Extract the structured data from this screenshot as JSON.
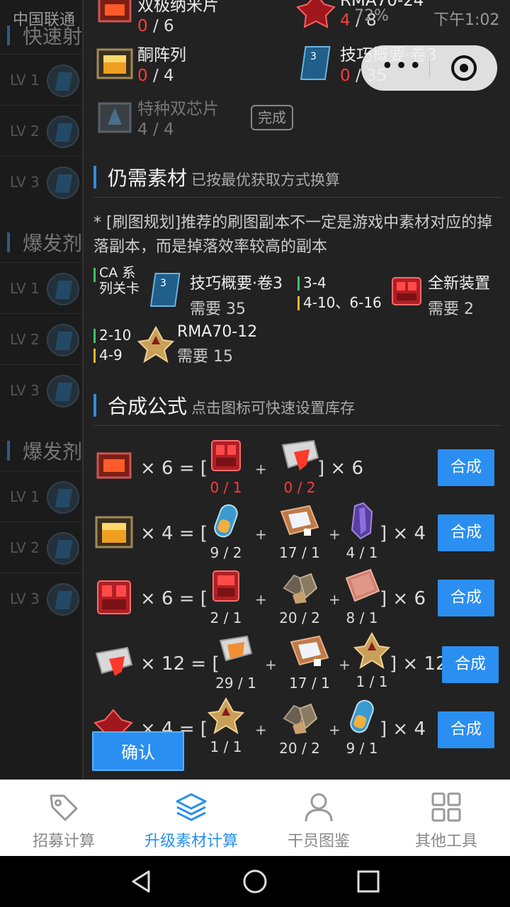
{
  "status_bar": {
    "carrier": "中国联通",
    "battery": "72%",
    "time": "下午1:02"
  },
  "background": {
    "sections": [
      "快速射",
      "爆发剂",
      "爆发剂"
    ],
    "levels": [
      "LV 1",
      "LV 2",
      "LV 3"
    ]
  },
  "dialog": {
    "owned": [
      {
        "name": "双极纳米片",
        "have": "0",
        "need": "/ 6",
        "icon": "nanoflake-icon"
      },
      {
        "name": "RMA70-24",
        "have": "4",
        "need": "/ 8",
        "icon": "rma70-24-icon"
      },
      {
        "name": "酮阵列",
        "have": "0",
        "need": "/ 4",
        "icon": "ketone-array-icon"
      },
      {
        "name": "技巧概要·卷3",
        "have": "0",
        "need": "/ 35",
        "icon": "skill-summary-3-icon"
      },
      {
        "name": "特种双芯片",
        "count": "4 / 4",
        "icon": "dualchip-icon"
      }
    ],
    "done_label": "完成",
    "still_needed": {
      "title": "仍需素材",
      "subtitle": "已按最优获取方式换算",
      "note": "* [刷图规划]推荐的刷图副本不一定是游戏中素材对应的掉落副本，而是掉落效率较高的副本",
      "ca_label": "CA 系列关卡",
      "items": [
        {
          "name": "技巧概要·卷3",
          "need": "需要 35",
          "stages": []
        },
        {
          "name": "全新装置",
          "need": "需要 2",
          "stages": [
            "3-4",
            "4-10、6-16"
          ]
        },
        {
          "name": "RMA70-12",
          "need": "需要 15",
          "stages": [
            "2-10",
            "4-9"
          ]
        }
      ]
    },
    "formula": {
      "title": "合成公式",
      "subtitle": "点击图标可快速设置库存",
      "make_label": "合成",
      "rows": [
        {
          "qty": "× 6 = [",
          "tail": "] × 6",
          "ings": [
            {
              "icon": "new-device-icon",
              "c": "0 / 1",
              "red": true
            },
            {
              "icon": "polyester-pack-icon",
              "c": "0 / 2",
              "red": true
            }
          ]
        },
        {
          "qty": "× 4 = [",
          "tail": "] × 4",
          "ings": [
            {
              "icon": "oriron-cluster-icon",
              "c": "9 / 2"
            },
            {
              "icon": "sugar-pack-icon",
              "c": "17 / 1"
            },
            {
              "icon": "manganese-icon",
              "c": "4 / 1"
            }
          ]
        },
        {
          "qty": "× 6 = [",
          "tail": "] × 6",
          "ings": [
            {
              "icon": "device-icon",
              "c": "2 / 1"
            },
            {
              "icon": "orirock-cube-icon",
              "c": "20 / 2"
            },
            {
              "icon": "grindstone-icon",
              "c": "8 / 1"
            }
          ]
        },
        {
          "qty": "× 12 = [",
          "tail": "] × 12",
          "ings": [
            {
              "icon": "polyester-icon",
              "c": "29 / 1"
            },
            {
              "icon": "sugar-icon",
              "c": "17 / 1"
            },
            {
              "icon": "rma70-12-icon",
              "c": "1 / 1"
            }
          ]
        },
        {
          "qty": "× 4 = [",
          "tail": "] × 4",
          "ings": [
            {
              "icon": "rma70-12-icon",
              "c": "1 / 1"
            },
            {
              "icon": "orirock-cube-icon",
              "c": "20 / 2"
            },
            {
              "icon": "oriron-cluster-icon",
              "c": "9 / 1"
            }
          ]
        }
      ]
    },
    "confirm_label": "确认"
  },
  "tabs": [
    {
      "label": "招募计算",
      "icon": "tag-icon",
      "active": false
    },
    {
      "label": "升级素材计算",
      "icon": "layers-icon",
      "active": true
    },
    {
      "label": "干员图鉴",
      "icon": "person-icon",
      "active": false
    },
    {
      "label": "其他工具",
      "icon": "grid-icon",
      "active": false
    }
  ],
  "colors": {
    "accent": "#2a8ff0",
    "shortage": "#ff3b3b",
    "panel": "#222222"
  }
}
